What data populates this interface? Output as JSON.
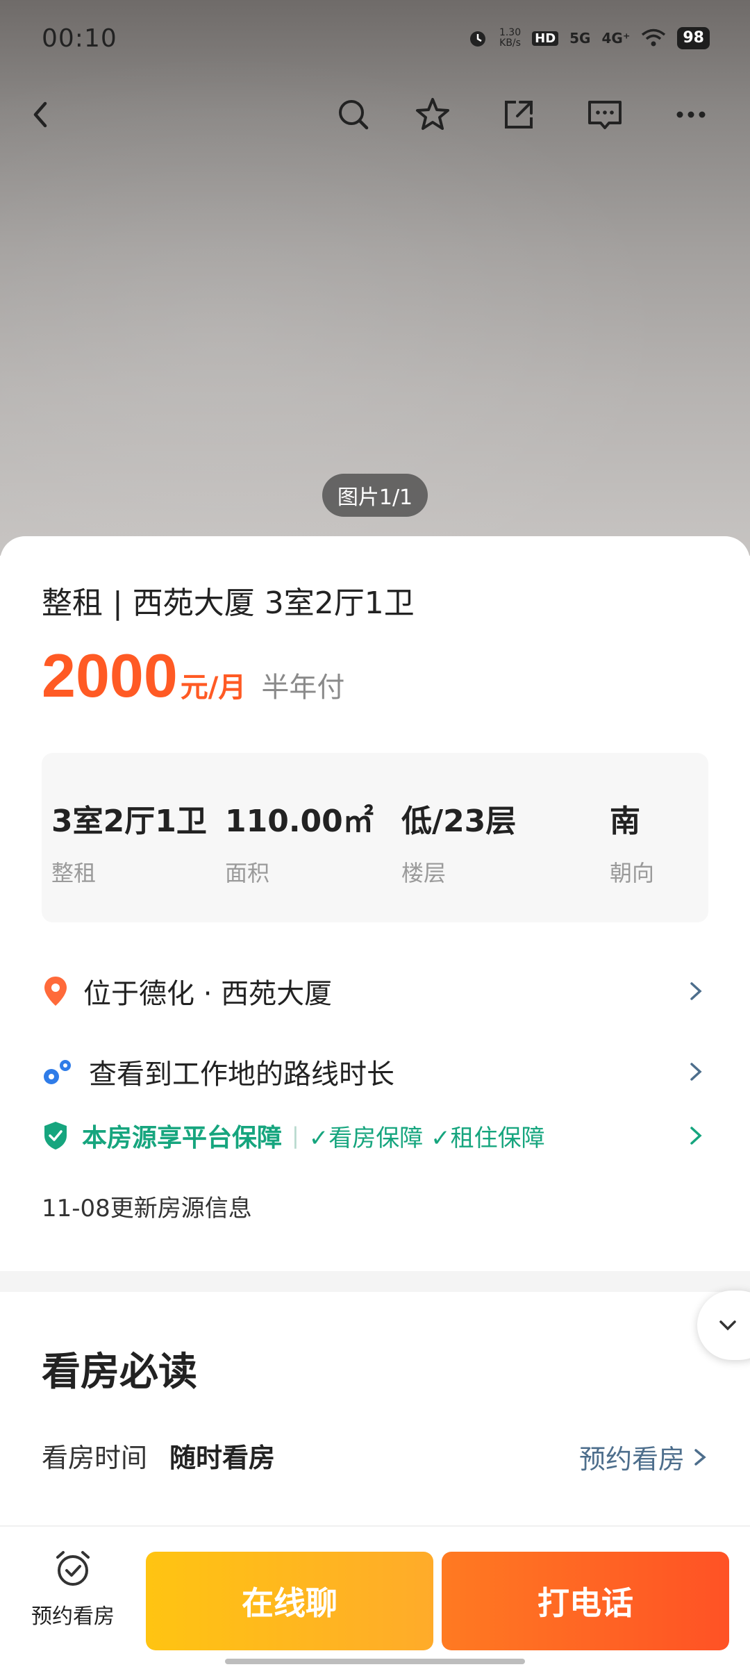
{
  "status": {
    "time": "00:10",
    "net_speed_top": "1.30",
    "net_speed_bottom": "KB/s",
    "hd": "HD",
    "sig1": "5G",
    "sig2": "4G⁺",
    "battery": "98"
  },
  "hero": {
    "photo_counter": "图片1/1"
  },
  "listing": {
    "title": "整租 | 西苑大厦 3室2厅1卫",
    "price": "2000",
    "unit": "元/月",
    "payment": "半年付",
    "specs": [
      {
        "value": "3室2厅1卫",
        "label": "整租"
      },
      {
        "value": "110.00㎡",
        "label": "面积"
      },
      {
        "value": "低/23层",
        "label": "楼层"
      },
      {
        "value": "南",
        "label": "朝向"
      }
    ],
    "location": "位于德化 · 西苑大厦",
    "route": "查看到工作地的路线时长",
    "guarantee": "本房源享平台保障",
    "guarantee_items": "✓看房保障 ✓租住保障",
    "updated": "11-08更新房源信息"
  },
  "viewing": {
    "section_title": "看房必读",
    "time_label": "看房时间",
    "time_value": "随时看房",
    "link": "预约看房"
  },
  "bottom": {
    "schedule_label": "预约看房",
    "chat_label": "在线聊",
    "call_label": "打电话"
  },
  "colors": {
    "accent_price": "#ff5a24",
    "guarantee_green": "#16a57e",
    "chat_button": "#ffc412",
    "call_button": "#ff5a24"
  }
}
